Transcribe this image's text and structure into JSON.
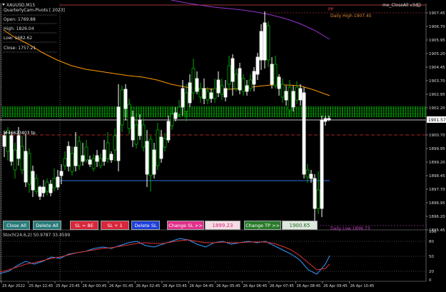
{
  "window": {
    "symbol_title": "XAUUSD,M15",
    "ea_label": "me_CloseAll v3d"
  },
  "info_panel": {
    "title": "QuarterlyCam-Pivots [ 2023]",
    "open": "Open: 1769.88",
    "high": "High: 1826.04",
    "low": "Low: 1682.62",
    "close": "Close: 1757.21"
  },
  "labels": {
    "pp": "PP",
    "daily_high": "Daily High 1907.45",
    "daily_low": "Daily Low 1896.73",
    "order_tag": "#46623403 tp"
  },
  "price_axis": {
    "ticks": [
      "1907.45",
      "1906.70",
      "1905.95",
      "1905.20",
      "1904.45",
      "1903.70",
      "1902.95",
      "1902.20",
      "1901.45",
      "1900.70",
      "1899.95",
      "1899.20",
      "1898.45",
      "1897.70",
      "1896.95",
      "1896.20",
      "1895.45"
    ],
    "current_price": "1901.57",
    "colors": {
      "current": "#ffffff"
    }
  },
  "buttons": {
    "close_all": "Close All",
    "delete_all": "Delete All",
    "sl_be": "SL = BE",
    "sl_plus": "SL + 1",
    "delete_sl": "Delete SL",
    "change_sl": "Change SL >>",
    "sl_value": "1899.23",
    "change_tp": "Change TP >>",
    "tp_value": "1900.65"
  },
  "stoch": {
    "title": "Stoch(24,6,2) 50.9787 33.4599",
    "levels": [
      "100",
      "80",
      "50",
      "20",
      "0"
    ]
  },
  "time_axis": {
    "labels": [
      "25 Apr 2022",
      "25 Apr 22:45",
      "25 Apr 23:45",
      "26 Apr 00:45",
      "26 Apr 01:45",
      "26 Apr 02:45",
      "26 Apr 03:45",
      "26 Apr 04:45",
      "26 Apr 05:45",
      "26 Apr 06:45",
      "26 Apr 07:45",
      "26 Apr 08:45",
      "26 Apr 09:45",
      "26 Apr 10:45"
    ]
  },
  "colors": {
    "bull": "#ffffff",
    "bear": "#00aa00",
    "ma_slow": "#9933cc",
    "ma_fast": "#ff9900",
    "green_band": "#00cc00",
    "red_dash": "#e03030",
    "blue_line": "#2a6fe0",
    "stoch_main": "#3399ff",
    "stoch_signal": "#dd3333"
  }
}
